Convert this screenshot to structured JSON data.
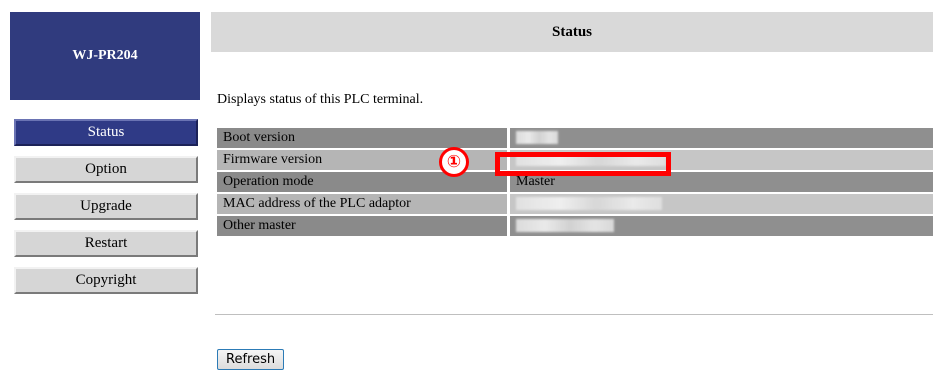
{
  "logo": {
    "text": "WJ-PR204"
  },
  "nav": {
    "items": [
      {
        "label": "Status",
        "active": true
      },
      {
        "label": "Option",
        "active": false
      },
      {
        "label": "Upgrade",
        "active": false
      },
      {
        "label": "Restart",
        "active": false
      },
      {
        "label": "Copyright",
        "active": false
      }
    ]
  },
  "header": {
    "title": "Status"
  },
  "description": "Displays status of this PLC terminal.",
  "status_rows": [
    {
      "label": "Boot version",
      "value": ""
    },
    {
      "label": "Firmware version",
      "value": ""
    },
    {
      "label": "Operation mode",
      "value": "Master"
    },
    {
      "label": "MAC address of the PLC adaptor",
      "value": ""
    },
    {
      "label": "Other master",
      "value": ""
    }
  ],
  "annotation": {
    "marker": "①",
    "color": "#ff0000"
  },
  "colors": {
    "brand": "#303b7e",
    "active_nav": "#2f3a86",
    "header_bg": "#d9d9d9"
  },
  "refresh_label": "Refresh"
}
